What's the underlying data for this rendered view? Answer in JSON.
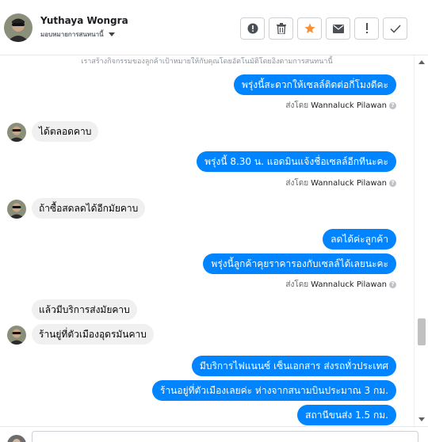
{
  "header": {
    "user_name": "Yuthaya Wongra",
    "user_subtitle": "มอบหมายการสนทนานี้",
    "actions": [
      {
        "name": "report-button",
        "icon": "exclamation-circle-icon"
      },
      {
        "name": "delete-button",
        "icon": "trash-icon"
      },
      {
        "name": "star-button",
        "icon": "star-icon"
      },
      {
        "name": "mark-unread-button",
        "icon": "envelope-icon"
      },
      {
        "name": "spam-button",
        "icon": "exclamation-icon"
      },
      {
        "name": "done-button",
        "icon": "check-icon"
      }
    ]
  },
  "chat": {
    "top_note": "เราสร้างกิจกรรมของลูกค้าเป้าหมายให้กับคุณโดยอัตโนมัติโดยอิงตามการสนทนานี้",
    "sent_by_label": "ส่งโดย",
    "agent_name": "Wannaluck Pilawan",
    "messages": [
      {
        "dir": "out",
        "text": "พรุ่งนี้สะดวกให้เซลล์ติดต่อกี่โมงดีคะ"
      },
      {
        "dir": "in",
        "text": "ได้ตลอดคาบ"
      },
      {
        "dir": "out",
        "text": "พรุ่งนี้ 8.30 น. แอดมินแจ้งชื่อเซลล์อีกทีนะคะ"
      },
      {
        "dir": "in",
        "text": "ถ้าซื้อสดลดได้อีกมัยคาบ"
      },
      {
        "dir": "out",
        "text": "ลดได้ค่ะลูกค้า"
      },
      {
        "dir": "out",
        "text": "พรุ่งนี้ลูกค้าคุยราคารองกับเซลล์ได้เลยนะคะ"
      },
      {
        "dir": "in",
        "text": "แล้วมีบริการส่งมัยคาบ"
      },
      {
        "dir": "in",
        "text": "ร้านยู่ที่ตัวเมืองอุดรมันคาบ"
      },
      {
        "dir": "out",
        "text": "มีบริการไฟแนนซ์ เซ็นเอกสาร ส่งรถทั่วประเทศ"
      },
      {
        "dir": "out",
        "text": "ร้านอยู่ที่ตัวเมืองเลยค่ะ  ห่างจากสนามบินประมาณ 3 กม."
      },
      {
        "dir": "out",
        "text": "สถานีขนส่ง 1.5 กม."
      }
    ]
  },
  "colors": {
    "outgoing_bubble": "#0084ff",
    "incoming_bubble": "#f1f0f0",
    "star_accent": "#f7923a"
  }
}
